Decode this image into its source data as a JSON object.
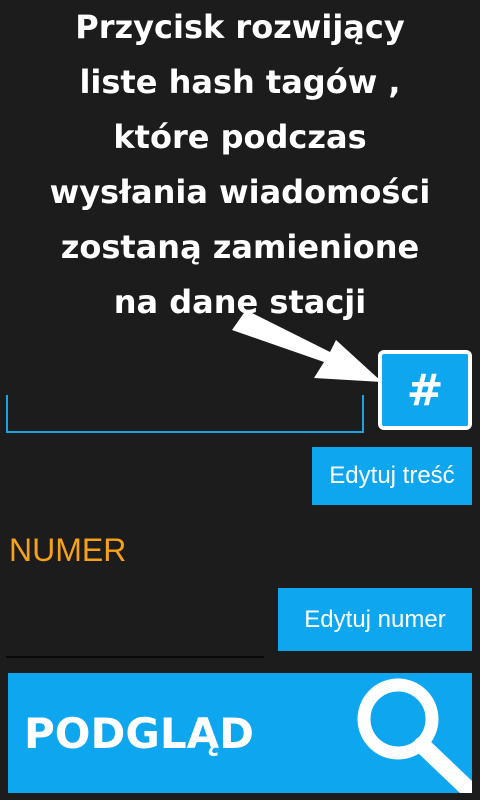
{
  "annotation": {
    "lines": [
      "Przycisk rozwijący",
      "liste hash tagów ,",
      "które podczas",
      "wysłania wiadomości",
      "zostaną zamienione",
      "na dane stacji"
    ]
  },
  "hash_button": {
    "label": "#"
  },
  "message_input": {
    "value": ""
  },
  "edit_content_button": {
    "label": "Edytuj treść"
  },
  "number_label": "NUMER",
  "number_input": {
    "value": ""
  },
  "edit_number_button": {
    "label": "Edytuj numer"
  },
  "preview_button": {
    "label": "PODGLĄD",
    "icon": "search-icon"
  },
  "colors": {
    "background": "#1c1c1c",
    "accent": "#0fa6f0",
    "label_orange": "#f6a11a",
    "text": "#ffffff"
  }
}
